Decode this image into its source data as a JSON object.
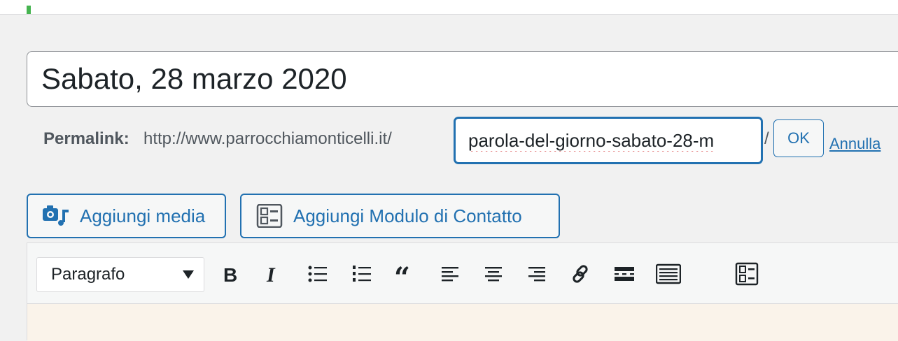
{
  "post": {
    "title": "Sabato, 28 marzo 2020"
  },
  "permalink": {
    "label": "Permalink:",
    "base_url": "http://www.parrocchiamonticelli.it/",
    "slug": "parola-del-giorno-sabato-28-m",
    "trailing_slash": "/",
    "ok_label": "OK",
    "cancel_label": "Annulla"
  },
  "media_buttons": {
    "add_media": {
      "label": "Aggiungi media",
      "icon": "media-camera-icon"
    },
    "add_contact_form": {
      "label": "Aggiungi Modulo di Contatto",
      "icon": "form-icon"
    }
  },
  "toolbar": {
    "format_value": "Paragrafo",
    "tools": [
      {
        "name": "bold-icon",
        "glyph": "B"
      },
      {
        "name": "italic-icon",
        "glyph": "I"
      },
      {
        "name": "bullet-list-icon"
      },
      {
        "name": "numbered-list-icon"
      },
      {
        "name": "blockquote-icon",
        "glyph": "“"
      },
      {
        "name": "align-left-icon"
      },
      {
        "name": "align-center-icon"
      },
      {
        "name": "align-right-icon"
      },
      {
        "name": "link-icon"
      },
      {
        "name": "read-more-icon"
      },
      {
        "name": "toolbar-toggle-icon"
      },
      {
        "name": "form-icon"
      }
    ]
  },
  "colors": {
    "accent": "#2271b1",
    "page_bg": "#f1f1f1",
    "editor_bg": "#faf3ea",
    "spell_error": "#d63638"
  }
}
